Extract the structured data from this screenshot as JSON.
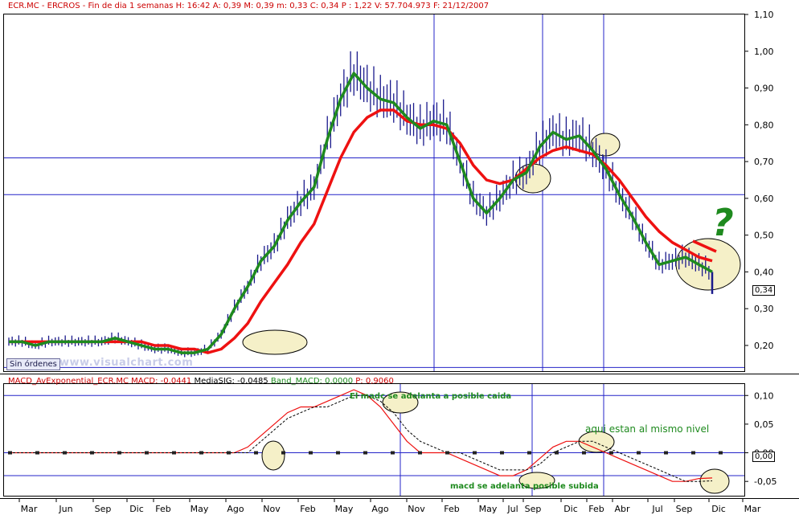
{
  "price_panel": {
    "header": {
      "symbol": "ECR.MC - ERCROS - Fin de dia 1 semanas",
      "h": "H: 16:42",
      "a": "A: 0,39",
      "m_high": "M: 0,39",
      "m_low": "m: 0,33",
      "c": "C: 0,34",
      "p": "P : 1,22",
      "v": "V: 57.704.973",
      "f": "F: 21/12/2007"
    },
    "last_price_badge": "0,34",
    "orders_button": "Sin órdenes",
    "watermark": "www.visualchart.com",
    "annotation": "?"
  },
  "macd_panel": {
    "header": {
      "name": "MACD_AvExponential_ECR.MC",
      "macd": "MACD: -0,0441",
      "signal": "MediaSIG: -0,0485",
      "band": "Band_MACD: 0,0000",
      "p": "P: 0,9060"
    },
    "zero_badge": "0,00",
    "notes": {
      "top": "El madc se adelanta a posible caida",
      "right": "aqui estan al mismo nivel",
      "bottom": "macd se adelanta posible subida"
    }
  },
  "colors": {
    "price_bars": "#1a1a8c",
    "fast_ma": "#1e8a1e",
    "slow_ma": "#ee1111",
    "hlines": "#2424c8",
    "macd_line": "#ee1111",
    "signal_line": "#000000",
    "ellipse_fill": "#f5f0c8",
    "header_text": "#cc0000"
  },
  "chart_data": [
    {
      "type": "line",
      "title": "ECR.MC - ERCROS - Fin de dia 1 semanas",
      "x": [
        "Mar",
        "Jun",
        "Sep",
        "Dic",
        "Feb",
        "May",
        "Ago",
        "Nov",
        "Feb",
        "May",
        "Ago",
        "Nov",
        "Feb",
        "May",
        "Jul",
        "Sep",
        "Dic",
        "Feb",
        "Abr",
        "Jul",
        "Sep",
        "Dic",
        "Mar"
      ],
      "ylim": [
        0.13,
        1.1
      ],
      "yticks": [
        0.2,
        0.3,
        0.4,
        0.5,
        0.6,
        0.7,
        0.8,
        0.9,
        1.0,
        1.1
      ],
      "ytick_labels": [
        "0,20",
        "0,30",
        "0,40",
        "0,50",
        "0,60",
        "0,70",
        "0,80",
        "0,90",
        "1,00",
        "1,10"
      ],
      "horizontal_lines": [
        0.71,
        0.61,
        0.14
      ],
      "vertical_line_labels": [
        "Nov",
        "Sep",
        "Feb"
      ],
      "series": [
        {
          "values": [
            0.21,
            0.21,
            0.2,
            0.21,
            0.21,
            0.21,
            0.21,
            0.21,
            0.22,
            0.21,
            0.2,
            0.19,
            0.19,
            0.18,
            0.18,
            0.19,
            0.23,
            0.3,
            0.36,
            0.43,
            0.47,
            0.54,
            0.59,
            0.63,
            0.76,
            0.87,
            0.94,
            0.9,
            0.87,
            0.86,
            0.82,
            0.79,
            0.81,
            0.8,
            0.7,
            0.6,
            0.56,
            0.6,
            0.65,
            0.67,
            0.74,
            0.78,
            0.76,
            0.77,
            0.73,
            0.68,
            0.61,
            0.55,
            0.48,
            0.42,
            0.43,
            0.44,
            0.42,
            0.4
          ]
        },
        {
          "values": [
            0.21,
            0.21,
            0.21,
            0.21,
            0.21,
            0.21,
            0.21,
            0.21,
            0.21,
            0.21,
            0.21,
            0.2,
            0.2,
            0.19,
            0.19,
            0.18,
            0.19,
            0.22,
            0.26,
            0.32,
            0.37,
            0.42,
            0.48,
            0.53,
            0.62,
            0.71,
            0.78,
            0.82,
            0.84,
            0.84,
            0.81,
            0.8,
            0.8,
            0.79,
            0.75,
            0.69,
            0.65,
            0.64,
            0.65,
            0.68,
            0.71,
            0.73,
            0.74,
            0.73,
            0.72,
            0.69,
            0.65,
            0.6,
            0.55,
            0.51,
            0.48,
            0.46,
            0.44,
            0.43
          ]
        }
      ],
      "last_price": 0.34
    },
    {
      "type": "line",
      "title": "MACD_AvExponential_ECR.MC",
      "ylim": [
        -0.075,
        0.12
      ],
      "yticks": [
        0.1,
        0.05,
        0.0,
        -0.05
      ],
      "ytick_labels": [
        "0,10",
        "0,05",
        "0,00",
        "-0,05"
      ],
      "horizontal_lines": [
        0.1,
        0.0,
        -0.04
      ],
      "series": [
        {
          "values": [
            0.0,
            0.0,
            0.0,
            0.0,
            0.0,
            0.0,
            0.0,
            0.0,
            0.0,
            0.0,
            0.0,
            0.0,
            0.0,
            0.0,
            0.0,
            0.0,
            0.0,
            0.0,
            0.01,
            0.03,
            0.05,
            0.07,
            0.08,
            0.08,
            0.09,
            0.1,
            0.11,
            0.1,
            0.08,
            0.05,
            0.02,
            0.0,
            0.0,
            0.0,
            -0.01,
            -0.02,
            -0.03,
            -0.04,
            -0.04,
            -0.03,
            -0.01,
            0.01,
            0.02,
            0.02,
            0.01,
            0.0,
            -0.01,
            -0.02,
            -0.03,
            -0.04,
            -0.05,
            -0.05,
            -0.045,
            -0.044
          ]
        },
        {
          "values": [
            0.0,
            0.0,
            0.0,
            0.0,
            0.0,
            0.0,
            0.0,
            0.0,
            0.0,
            0.0,
            0.0,
            0.0,
            0.0,
            0.0,
            0.0,
            0.0,
            0.0,
            0.0,
            0.0,
            0.02,
            0.04,
            0.06,
            0.07,
            0.08,
            0.08,
            0.09,
            0.1,
            0.1,
            0.09,
            0.07,
            0.04,
            0.02,
            0.01,
            0.0,
            0.0,
            -0.01,
            -0.02,
            -0.03,
            -0.03,
            -0.03,
            -0.02,
            0.0,
            0.01,
            0.02,
            0.02,
            0.01,
            0.0,
            -0.01,
            -0.02,
            -0.03,
            -0.04,
            -0.05,
            -0.05,
            -0.049
          ]
        }
      ]
    }
  ]
}
